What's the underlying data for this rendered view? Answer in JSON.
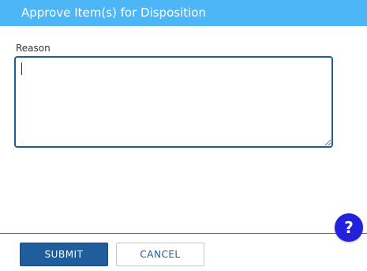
{
  "dialog": {
    "title": "Approve Item(s) for Disposition"
  },
  "form": {
    "reason_label": "Reason",
    "reason_value": "",
    "reason_placeholder": ""
  },
  "footer": {
    "submit_label": "SUBMIT",
    "cancel_label": "CANCEL",
    "help_label": "?"
  },
  "colors": {
    "header_bg": "#4db6f7",
    "primary": "#1f5d9c",
    "help_button": "#2222dd",
    "divider": "#2b7bc1"
  },
  "icons": {
    "help": "question-mark-icon"
  }
}
